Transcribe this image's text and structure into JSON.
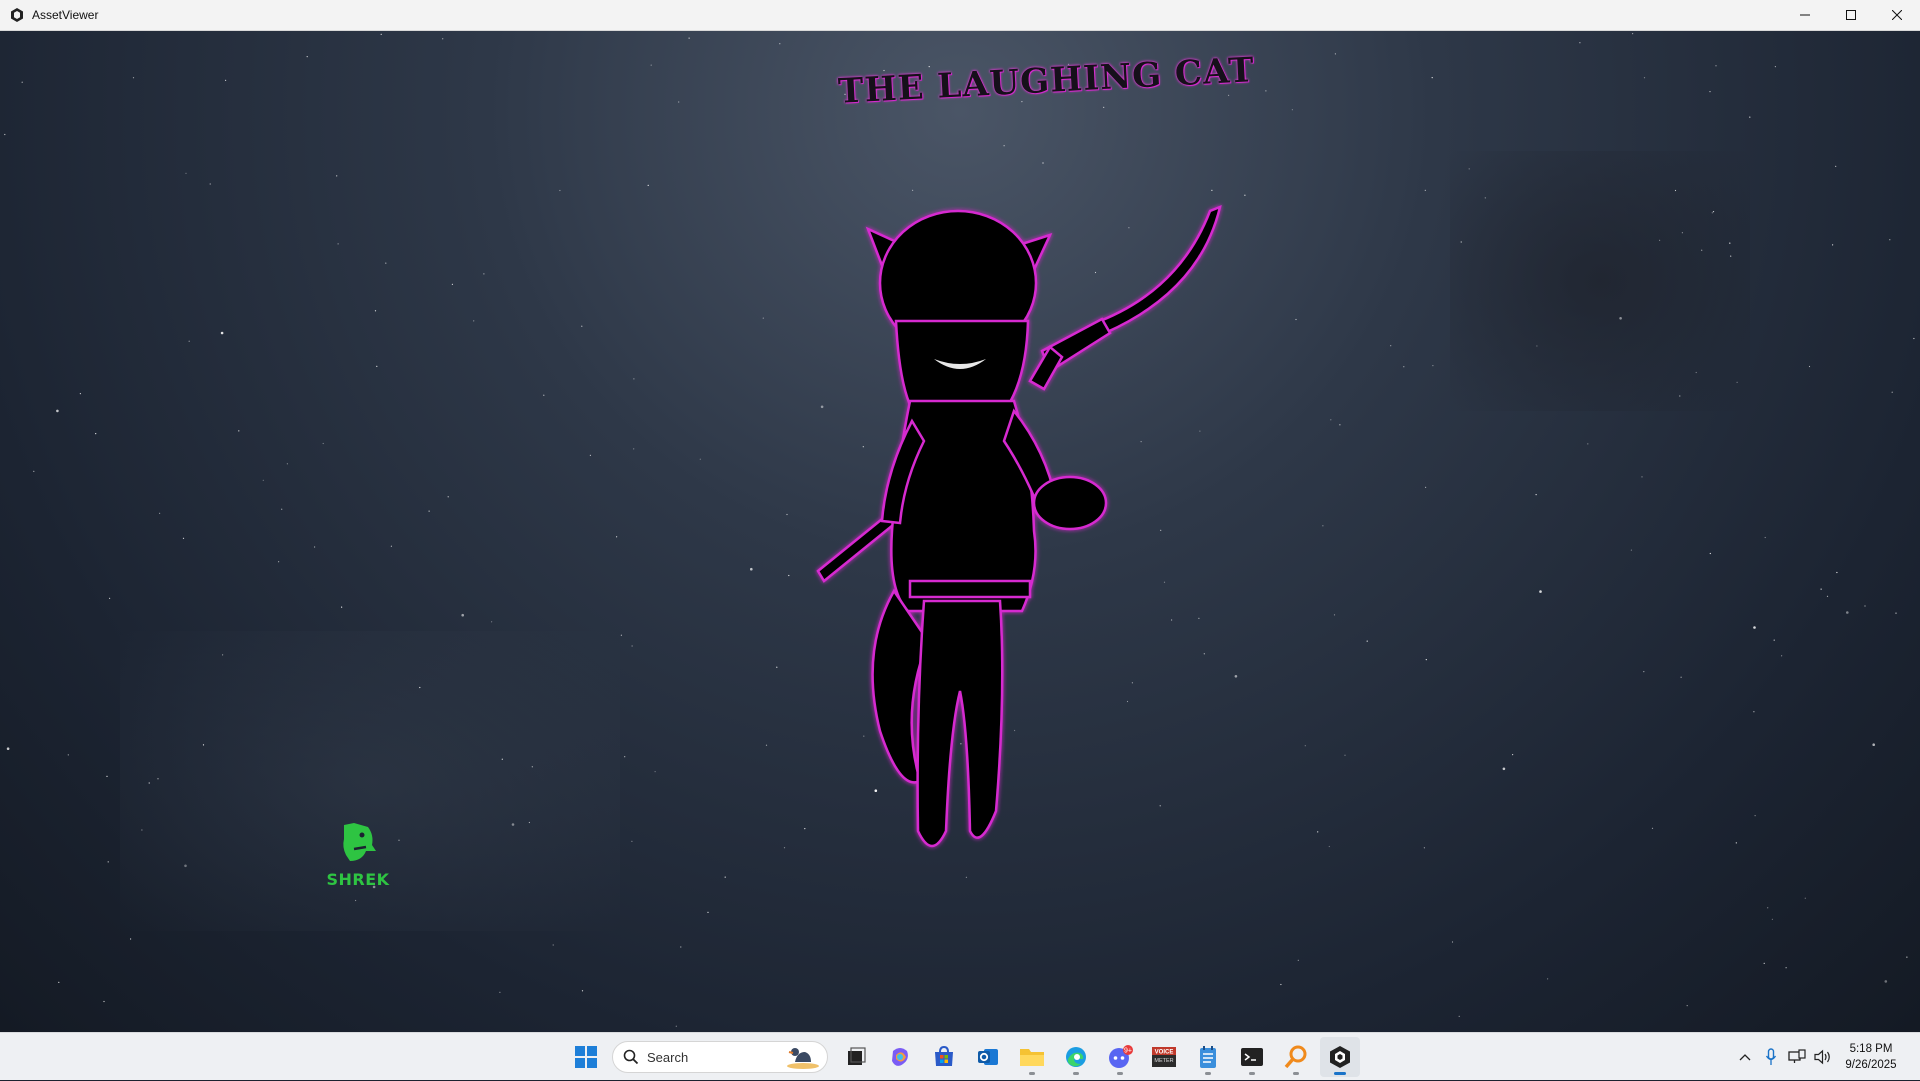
{
  "window": {
    "title": "AssetViewer"
  },
  "viewport": {
    "logo_text": "THE LAUGHING CAT",
    "watermark": {
      "text": "SHREK",
      "color": "#2ec442"
    },
    "accent_color": "#e23ad8"
  },
  "taskbar": {
    "search_placeholder": "Search",
    "apps": [
      {
        "name": "task-view",
        "icon": "task-view-icon"
      },
      {
        "name": "copilot",
        "icon": "copilot-icon"
      },
      {
        "name": "microsoft-store",
        "icon": "store-icon"
      },
      {
        "name": "outlook",
        "icon": "outlook-icon"
      },
      {
        "name": "file-explorer",
        "icon": "folder-icon"
      },
      {
        "name": "edge",
        "icon": "edge-icon"
      },
      {
        "name": "discord",
        "icon": "discord-icon",
        "badge": "9+"
      },
      {
        "name": "voicemeeter",
        "icon": "voicemeeter-icon",
        "label": "VOICE METER"
      },
      {
        "name": "notepad",
        "icon": "notepad-icon"
      },
      {
        "name": "terminal",
        "icon": "terminal-icon"
      },
      {
        "name": "search-tool",
        "icon": "magnifier-icon"
      },
      {
        "name": "assetviewer",
        "icon": "unity-icon",
        "active": true
      }
    ],
    "clock": {
      "time": "5:18 PM",
      "date": "9/26/2025"
    }
  }
}
